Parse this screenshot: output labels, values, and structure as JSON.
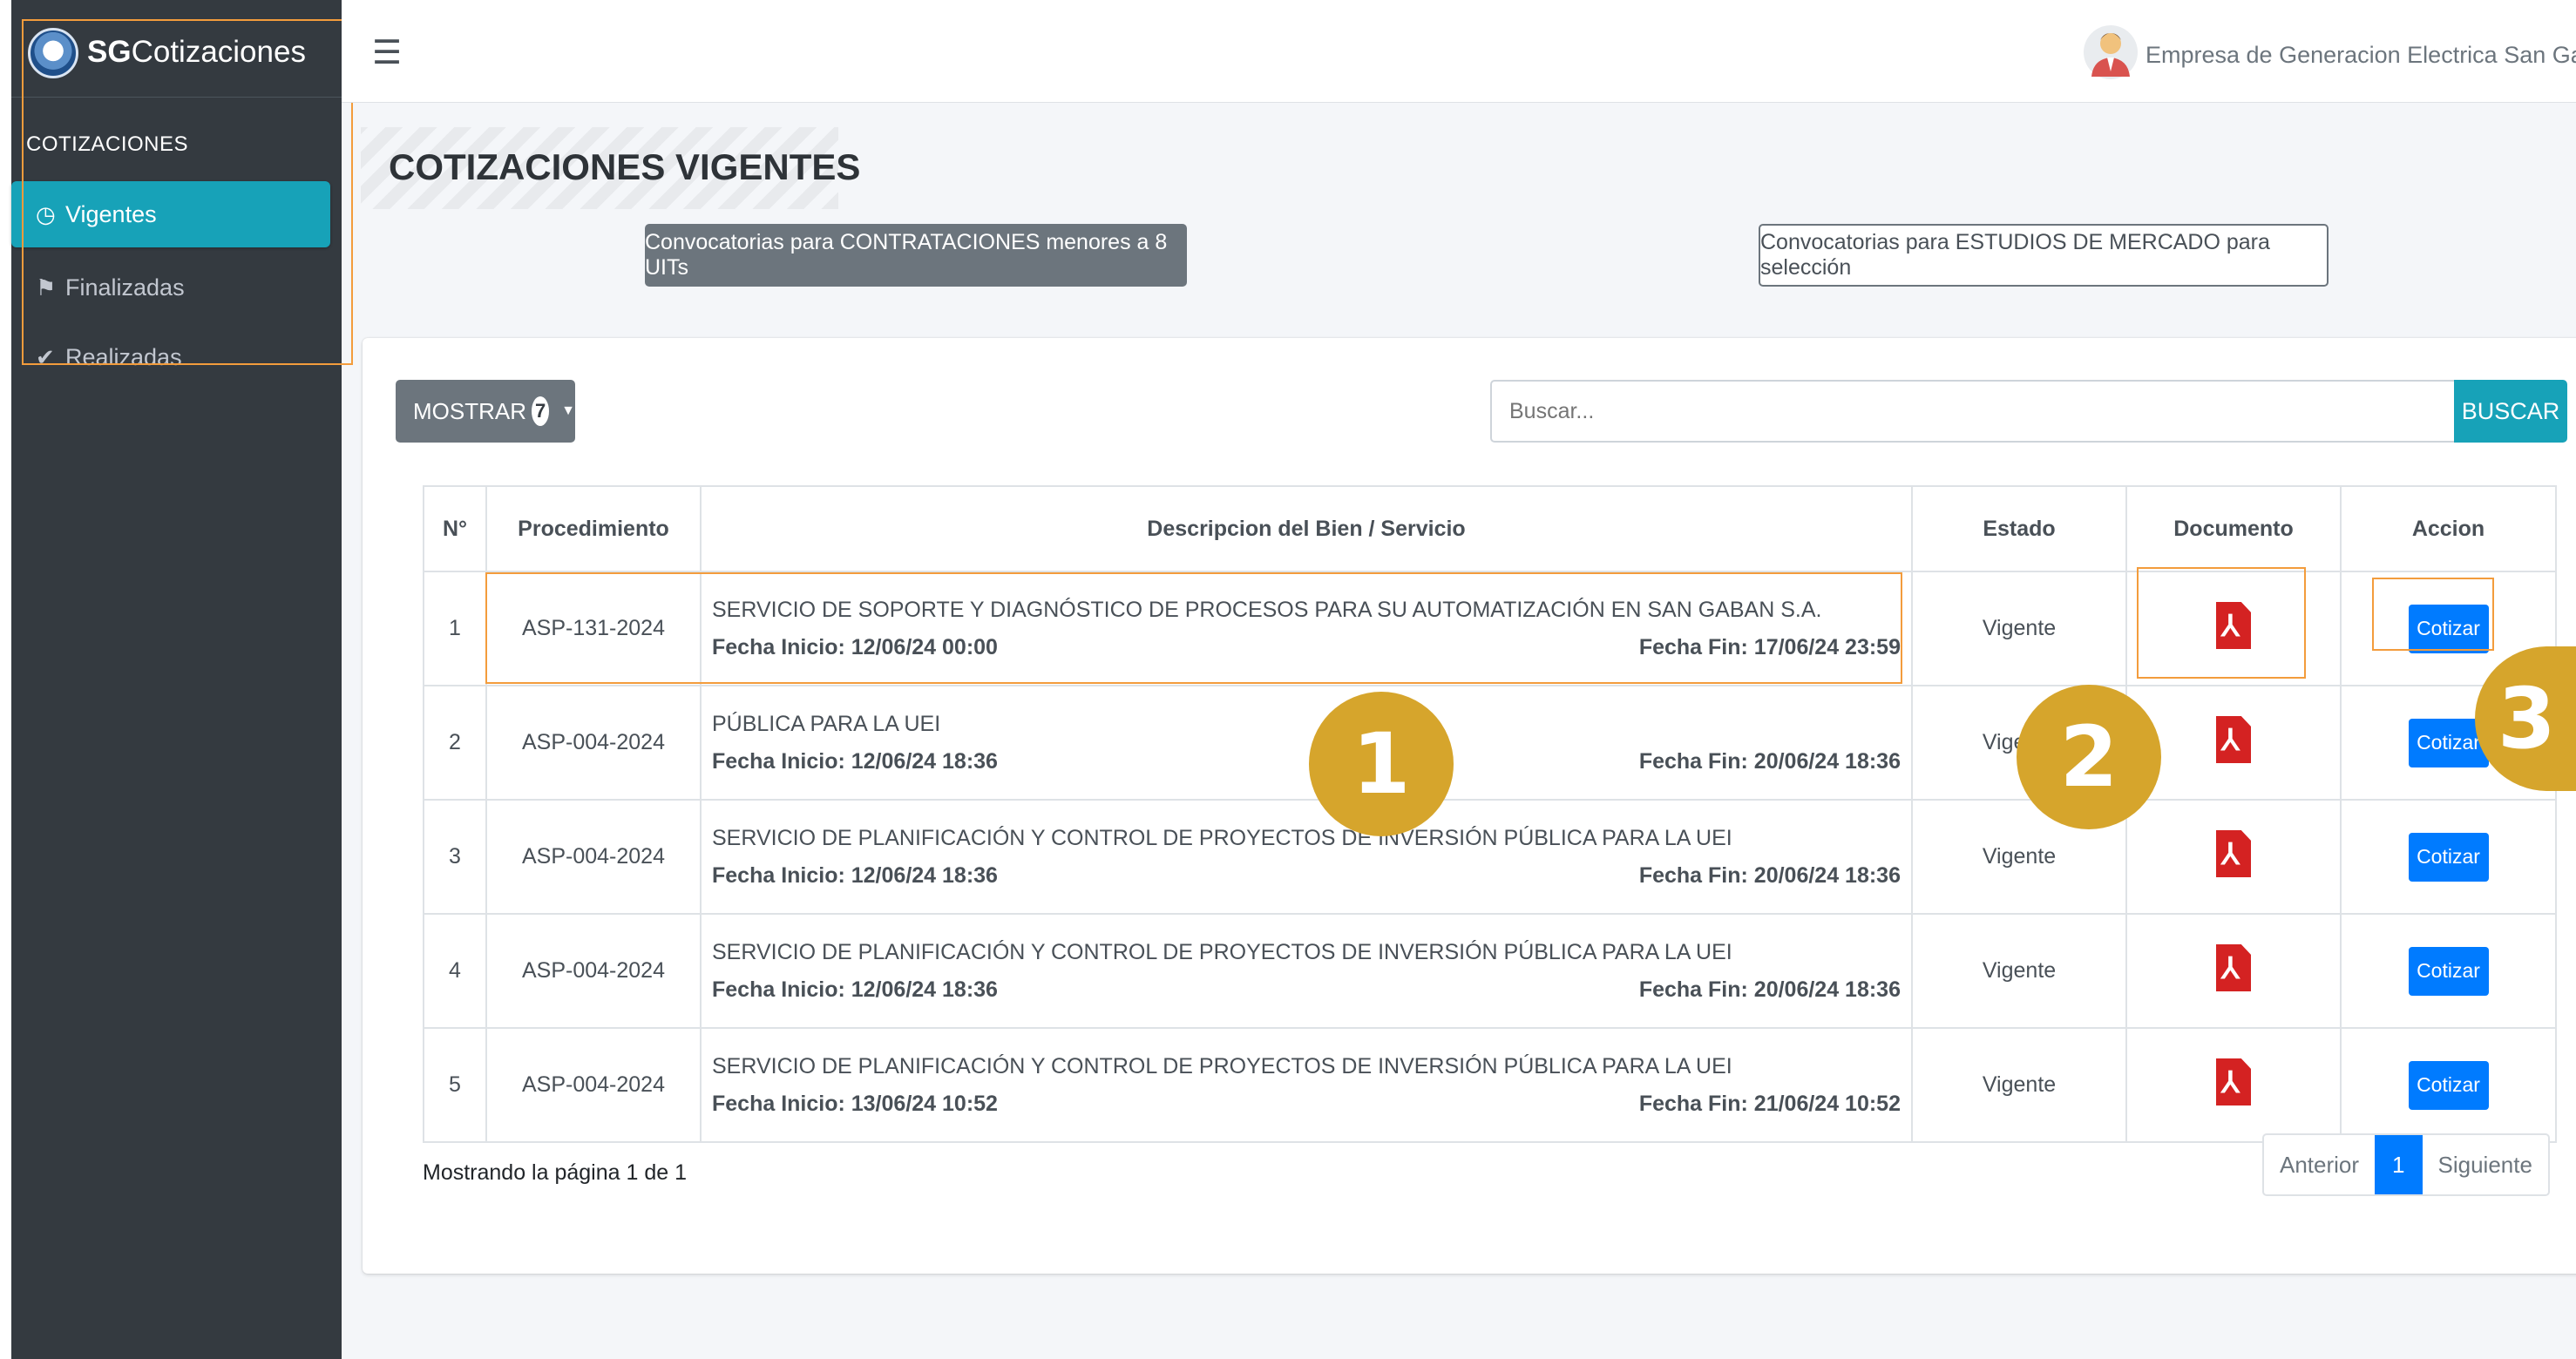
{
  "brand": {
    "bold": "SG",
    "rest": "Cotizaciones"
  },
  "sidebar": {
    "header": "COTIZACIONES",
    "items": [
      {
        "label": "Vigentes",
        "icon": "clock-icon"
      },
      {
        "label": "Finalizadas",
        "icon": "flag-icon"
      },
      {
        "label": "Realizadas",
        "icon": "check-icon"
      }
    ]
  },
  "topbar": {
    "menu_icon": "hamburger-icon",
    "user": "Empresa de Generacion Electrica San Gaban S.A"
  },
  "page": {
    "title": "COTIZACIONES VIGENTES",
    "btn_contrataciones": "Convocatorias para CONTRATACIONES menores a 8 UITs",
    "btn_estudios": "Convocatorias para ESTUDIOS DE MERCADO para selección"
  },
  "controls": {
    "mostrar_label": "MOSTRAR",
    "mostrar_count": "7",
    "search_placeholder": "Buscar...",
    "buscar_label": "BUSCAR"
  },
  "table": {
    "headers": [
      "N°",
      "Procedimiento",
      "Descripcion del Bien / Servicio",
      "Estado",
      "Documento",
      "Accion"
    ],
    "rows": [
      {
        "n": "1",
        "proc": "ASP-131-2024",
        "desc": "SERVICIO DE SOPORTE Y DIAGNÓSTICO DE PROCESOS PARA SU AUTOMATIZACIÓN EN SAN GABAN S.A.",
        "inicio": "Fecha Inicio: 12/06/24 00:00",
        "fin": "Fecha Fin: 17/06/24 23:59",
        "estado": "Vigente",
        "accion": "Cotizar"
      },
      {
        "n": "2",
        "proc": "ASP-004-2024",
        "desc": "PÚBLICA PARA LA UEI",
        "inicio": "Fecha Inicio: 12/06/24 18:36",
        "fin": "Fecha Fin: 20/06/24 18:36",
        "estado": "Vigente",
        "accion": "Cotizar"
      },
      {
        "n": "3",
        "proc": "ASP-004-2024",
        "desc": "SERVICIO DE PLANIFICACIÓN Y CONTROL DE PROYECTOS DE INVERSIÓN PÚBLICA PARA LA UEI",
        "inicio": "Fecha Inicio: 12/06/24 18:36",
        "fin": "Fecha Fin: 20/06/24 18:36",
        "estado": "Vigente",
        "accion": "Cotizar"
      },
      {
        "n": "4",
        "proc": "ASP-004-2024",
        "desc": "SERVICIO DE PLANIFICACIÓN Y CONTROL DE PROYECTOS DE INVERSIÓN PÚBLICA PARA LA UEI",
        "inicio": "Fecha Inicio: 12/06/24 18:36",
        "fin": "Fecha Fin: 20/06/24 18:36",
        "estado": "Vigente",
        "accion": "Cotizar"
      },
      {
        "n": "5",
        "proc": "ASP-004-2024",
        "desc": "SERVICIO DE PLANIFICACIÓN Y CONTROL DE PROYECTOS DE INVERSIÓN PÚBLICA PARA LA UEI",
        "inicio": "Fecha Inicio: 13/06/24 10:52",
        "fin": "Fecha Fin: 21/06/24 10:52",
        "estado": "Vigente",
        "accion": "Cotizar"
      }
    ]
  },
  "footer": {
    "info": "Mostrando la página 1 de 1",
    "prev": "Anterior",
    "page": "1",
    "next": "Siguiente"
  },
  "annotations": {
    "m1": "1",
    "m2": "2",
    "m3": "3"
  },
  "colors": {
    "sidebar": "#343a40",
    "active": "#17a2b8",
    "primary": "#007bff",
    "highlight": "#f39c3c",
    "marker": "#d6a52c",
    "pdf": "#d42222"
  }
}
